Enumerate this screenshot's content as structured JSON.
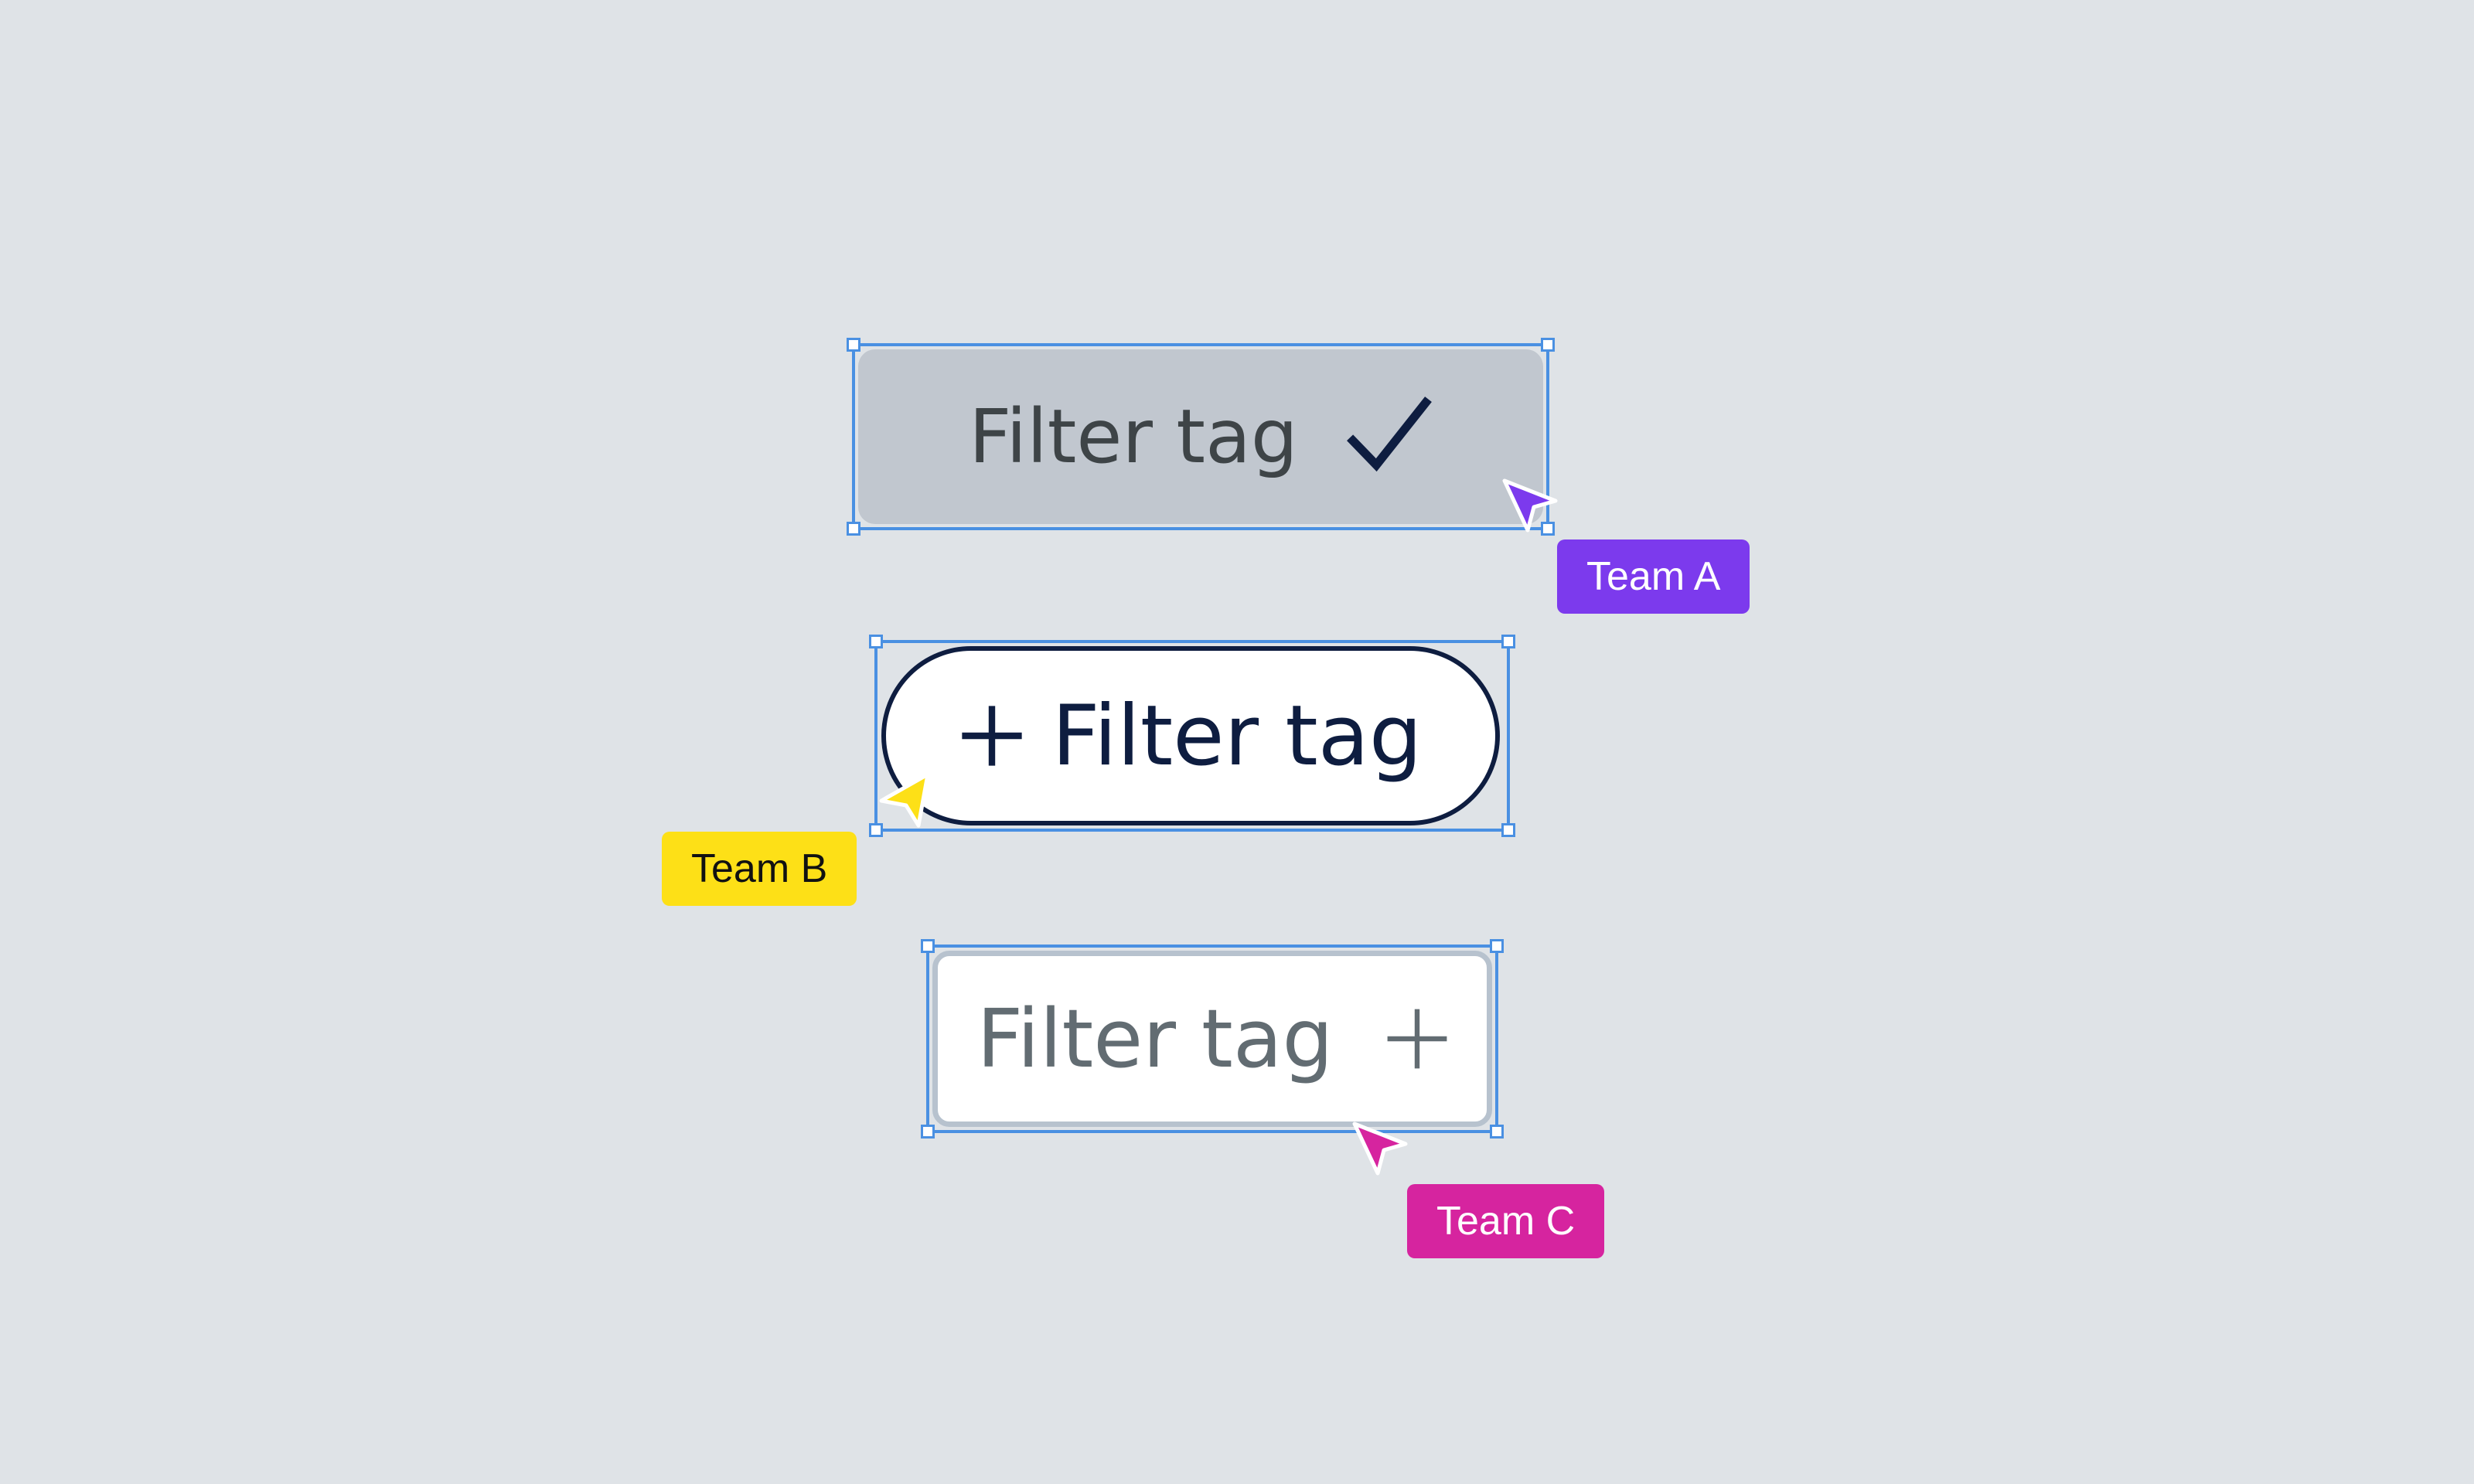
{
  "canvas": {
    "background": "#DFE3E7",
    "selection_color": "#4A90E2"
  },
  "tags": [
    {
      "variant": "selected-checked",
      "label": "Filter tag",
      "icon": "checkmark-icon",
      "fill": "#C1C7CF",
      "text_color": "#3E4447",
      "icon_color": "#0E1D40"
    },
    {
      "variant": "add-pill-outlined",
      "label": "Filter tag",
      "icon": "plus-icon",
      "fill": "#FFFFFF",
      "border_color": "#0E1D40",
      "text_color": "#0E1D40"
    },
    {
      "variant": "add-outlined",
      "label": "Filter tag",
      "icon": "plus-icon",
      "fill": "#FFFFFF",
      "border_color": "#B7C2CE",
      "text_color": "#626C72"
    }
  ],
  "collaborators": [
    {
      "name": "Team A",
      "color": "#7C3AED",
      "text_color": "#FFFFFF",
      "icon": "cursor-arrow-icon"
    },
    {
      "name": "Team B",
      "color": "#FDE017",
      "text_color": "#111111",
      "icon": "cursor-arrow-icon"
    },
    {
      "name": "Team C",
      "color": "#D6249F",
      "text_color": "#FFFFFF",
      "icon": "cursor-arrow-icon"
    }
  ]
}
